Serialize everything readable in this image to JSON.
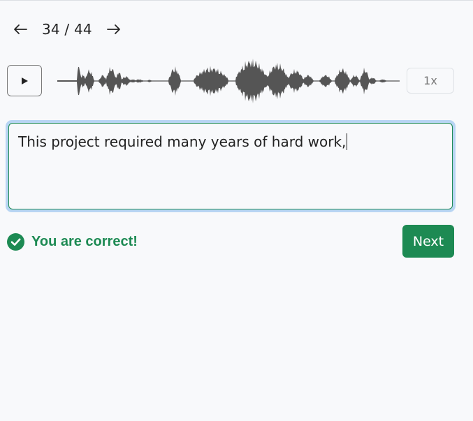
{
  "navigation": {
    "prev_icon": "arrow-left-icon",
    "next_icon": "arrow-right-icon",
    "current": "34",
    "separator": "/",
    "total": "44"
  },
  "player": {
    "play_icon": "play-icon",
    "speed_label": "1x"
  },
  "answer": {
    "value": "This project required many years of hard work,"
  },
  "feedback": {
    "icon": "check-circle-icon",
    "message": "You are correct!"
  },
  "actions": {
    "next_label": "Next"
  },
  "colors": {
    "success": "#1d8a53",
    "focus_ring": "#b8d5f3",
    "waveform": "#555555",
    "background": "#f8f9fb"
  }
}
